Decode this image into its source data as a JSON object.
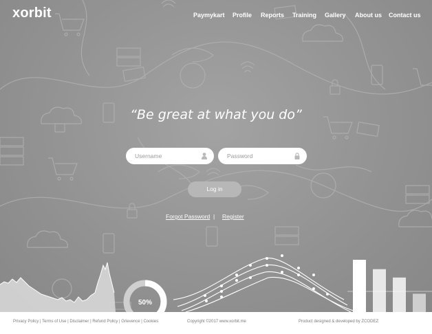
{
  "header": {
    "logo": "xorbit",
    "nav": [
      "Paymykart",
      "Profile",
      "Reports",
      "Training",
      "Gallery",
      "About us",
      "Contact us"
    ]
  },
  "hero": {
    "headline": "“Be great at what you do”"
  },
  "login_form": {
    "username_placeholder": "Username",
    "password_placeholder": "Password",
    "login_label": "Log in",
    "forgot_label": "Forgot Password",
    "separator": "|",
    "register_label": "Register"
  },
  "decor_charts": {
    "donut_label": "50%",
    "donut_percent": 50,
    "bar_values": [
      100,
      82,
      66,
      35
    ]
  },
  "footer": {
    "links": [
      "Privacy Policy",
      "Terms of Use",
      "Disclaimer",
      "Refund Policy",
      "Grievence",
      "Cookies"
    ],
    "copyright": "Copyright ©2017 www.xorbit.me",
    "credit": "Product designed & developed by ZCODEZ"
  },
  "colors": {
    "background": "#8f8f8f",
    "text": "#ffffff",
    "button": "#b7b7b7",
    "footer_bg": "#ffffff",
    "footer_text": "#7a7a7a"
  }
}
